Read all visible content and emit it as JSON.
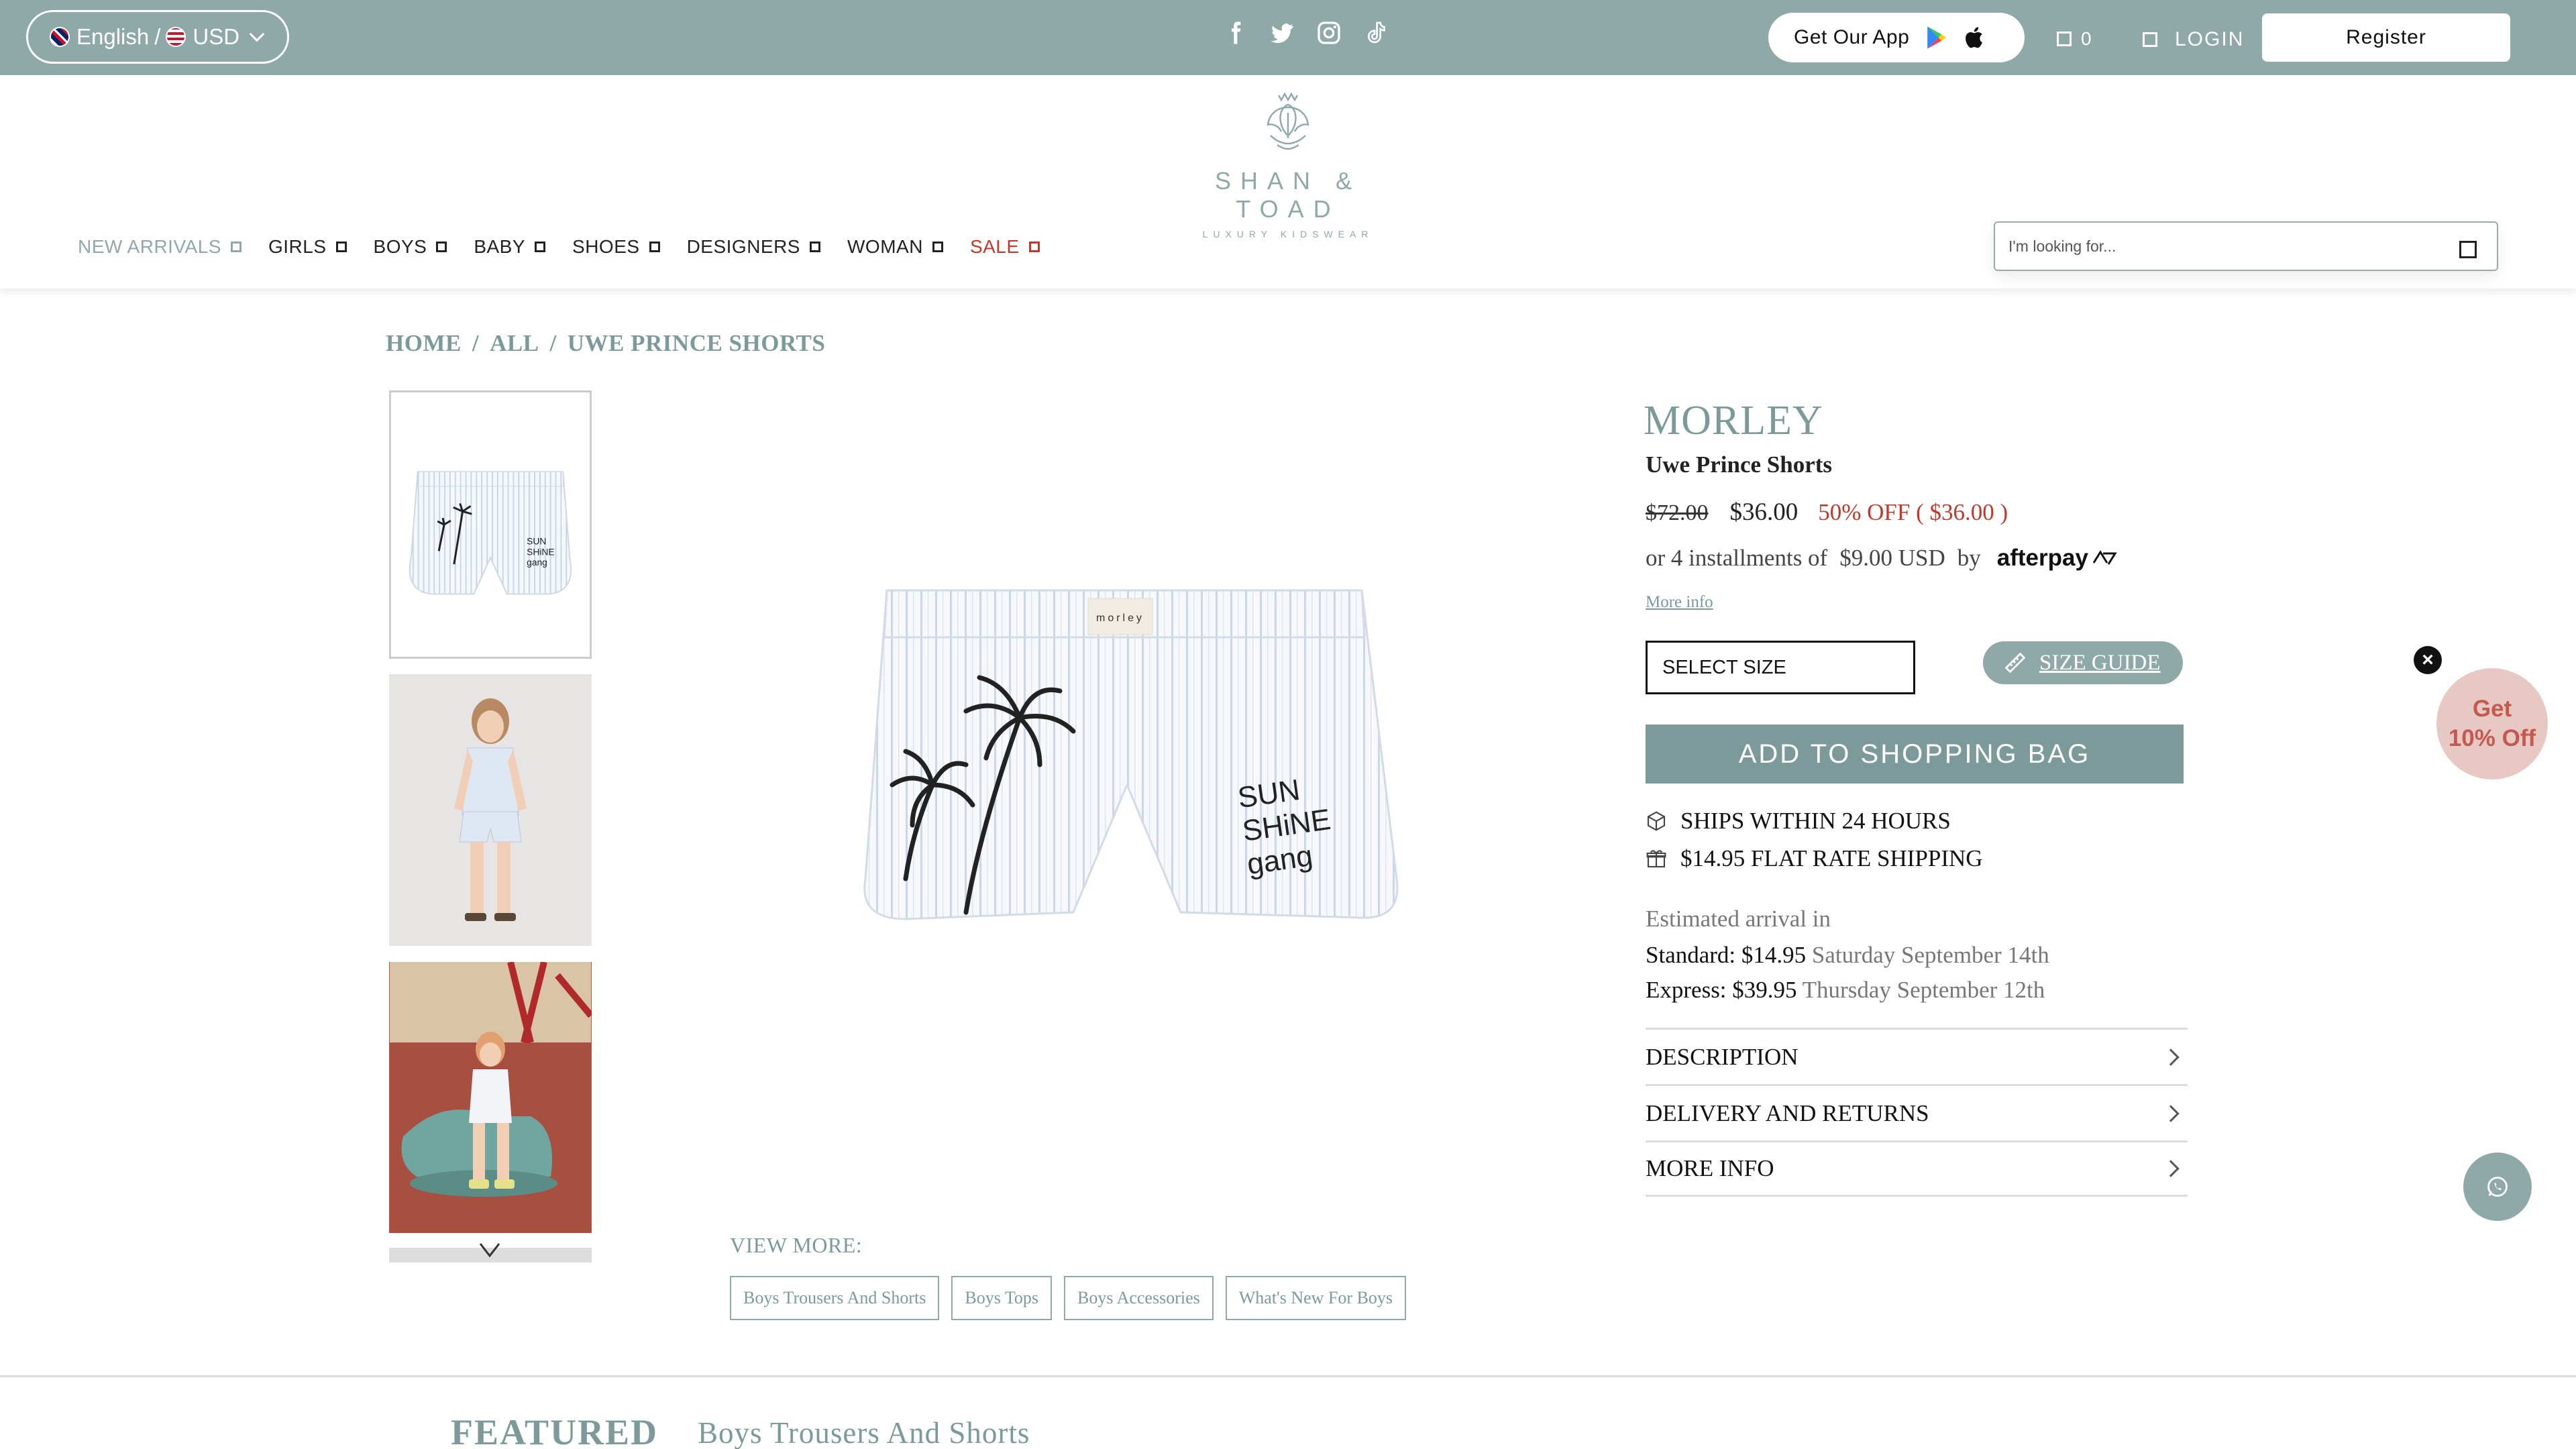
{
  "topbar": {
    "language": "English",
    "currency": "USD",
    "app_label": "Get Our App",
    "cart_count": "0",
    "login_label": "LOGIN",
    "register_label": "Register",
    "bg_color": "#8fa9a9"
  },
  "logo": {
    "name": "SHAN & TOAD",
    "tagline": "LUXURY KIDSWEAR"
  },
  "nav": {
    "items": [
      {
        "label": "NEW ARRIVALS"
      },
      {
        "label": "GIRLS"
      },
      {
        "label": "BOYS"
      },
      {
        "label": "BABY"
      },
      {
        "label": "SHOES"
      },
      {
        "label": "DESIGNERS"
      },
      {
        "label": "WOMAN"
      },
      {
        "label": "SALE"
      }
    ]
  },
  "search": {
    "placeholder": "I'm looking for..."
  },
  "breadcrumb": {
    "home": "HOME",
    "sep": "/",
    "all": "ALL",
    "current": "UWE PRINCE SHORTS"
  },
  "product": {
    "brand": "MORLEY",
    "name": "Uwe Prince Shorts",
    "old_price": "$72.00",
    "new_price": "$36.00",
    "discount": "50% OFF ( $36.00 )",
    "installments_prefix": "or 4 installments of",
    "installment_amount": "$9.00 USD",
    "installments_by": "by",
    "afterpay": "afterpay",
    "more_info": "More info",
    "size_select": "SELECT SIZE",
    "size_guide": "SIZE GUIDE",
    "add_to_bag": "ADD TO SHOPPING BAG",
    "ships_within": "SHIPS WITHIN 24 HOURS",
    "flat_rate": "$14.95 FLAT RATE SHIPPING",
    "estimated_label": "Estimated arrival in",
    "standard_label": "Standard: $14.95",
    "standard_date": "Saturday September 14th",
    "express_label": "Express: $39.95",
    "express_date": "Thursday September 12th",
    "accordion": [
      {
        "label": "DESCRIPTION"
      },
      {
        "label": "DELIVERY AND RETURNS"
      },
      {
        "label": "MORE INFO"
      }
    ],
    "shorts_print_line1": "SUN",
    "shorts_print_line2": "SHiNE",
    "shorts_print_line3": "gang",
    "waistband_label": "morley"
  },
  "view_more": {
    "label": "VIEW MORE:",
    "chips": [
      {
        "label": "Boys Trousers And Shorts"
      },
      {
        "label": "Boys Tops"
      },
      {
        "label": "Boys Accessories"
      },
      {
        "label": "What's New For Boys"
      }
    ]
  },
  "promo": {
    "line1": "Get",
    "line2": "10% Off"
  },
  "featured": {
    "title": "FEATURED",
    "subtitle": "Boys Trousers And Shorts"
  },
  "colors": {
    "accent": "#7c9a9a",
    "sale": "#c0392b",
    "promo": "#e7c8c3"
  }
}
